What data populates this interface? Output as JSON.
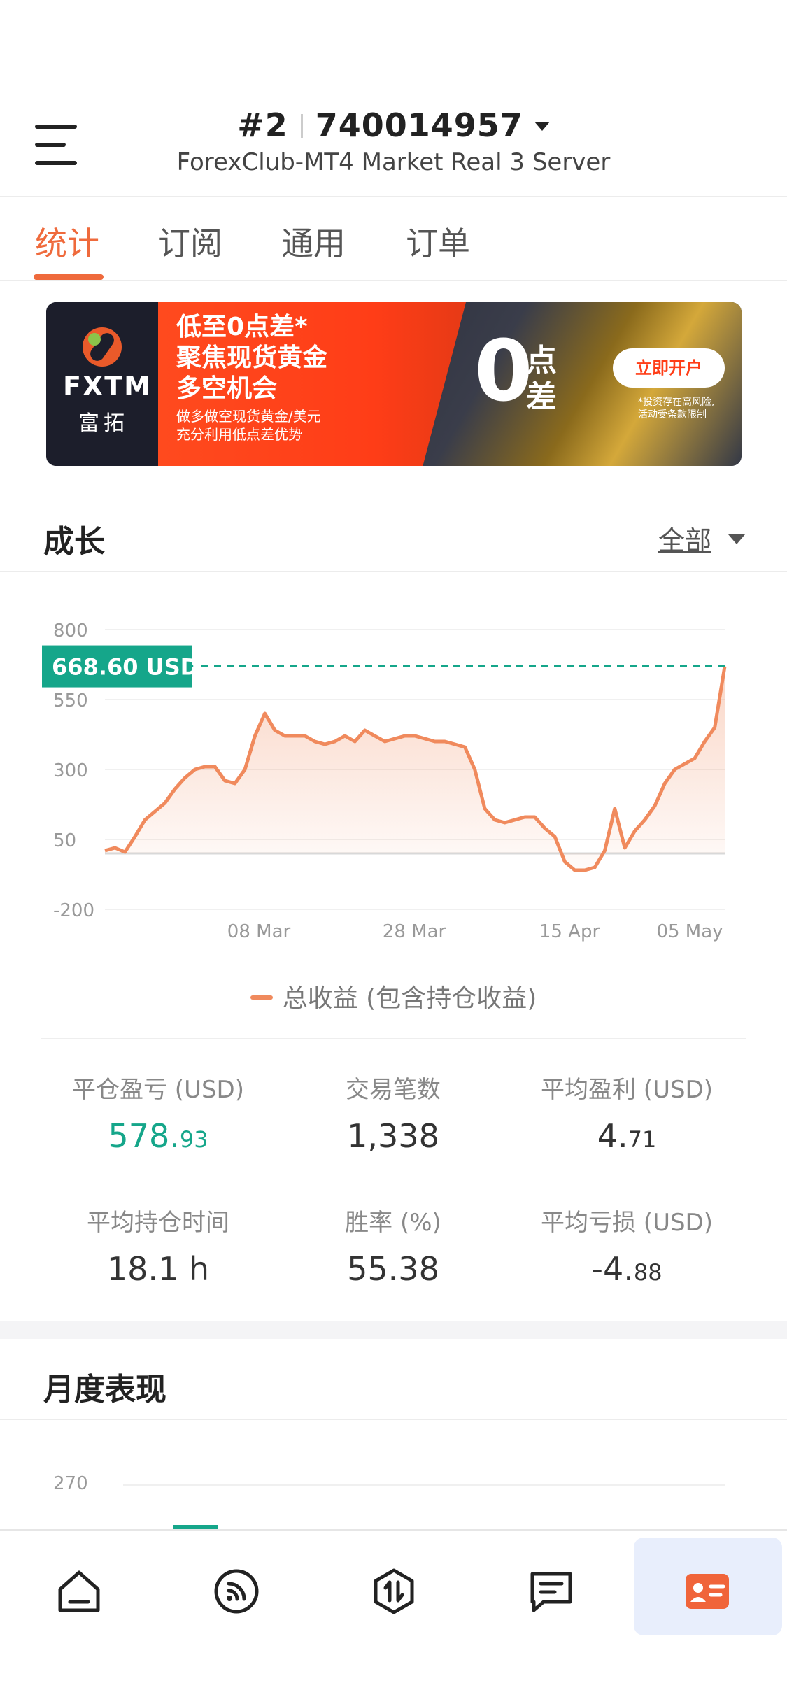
{
  "header": {
    "account_index": "#2",
    "account_number": "740014957",
    "server": "ForexClub-MT4 Market Real 3 Server"
  },
  "tabs": [
    "统计",
    "订阅",
    "通用",
    "订单"
  ],
  "banner": {
    "brand": "FXTM",
    "brand_cn": "富拓",
    "headline": [
      "低至0点差*",
      "聚焦现货黄金",
      "多空机会"
    ],
    "sub": [
      "做多做空现货黄金/美元",
      "充分利用低点差优势"
    ],
    "zero": "0",
    "zero_cn": [
      "点",
      "差"
    ],
    "cta": "立即开户",
    "risk": [
      "*投资存在高风险,",
      "活动受条款限制"
    ]
  },
  "growth": {
    "title": "成长",
    "filter": "全部"
  },
  "chart_data": {
    "type": "area",
    "ylim": [
      -200,
      800
    ],
    "y_ticks": [
      800,
      550,
      300,
      50,
      -200
    ],
    "x_tick_labels": [
      "08 Mar",
      "28 Mar",
      "15 Apr",
      "05 May"
    ],
    "current_label": "668.60 USD",
    "current_value": 668.6,
    "series": [
      {
        "name": "总收益 (包含持仓收益)",
        "color": "#f08a5d",
        "values": [
          10,
          20,
          5,
          60,
          120,
          150,
          180,
          230,
          270,
          300,
          310,
          310,
          260,
          250,
          300,
          420,
          500,
          440,
          420,
          420,
          420,
          400,
          390,
          400,
          420,
          400,
          440,
          420,
          400,
          410,
          420,
          420,
          410,
          400,
          400,
          390,
          380,
          300,
          160,
          120,
          110,
          120,
          130,
          130,
          90,
          60,
          -30,
          -60,
          -60,
          -50,
          10,
          160,
          20,
          80,
          120,
          170,
          250,
          300,
          320,
          340,
          400,
          450,
          668.6
        ]
      }
    ]
  },
  "legend": "总收益 (包含持仓收益)",
  "stats": [
    {
      "label": "平仓盈亏 (USD)",
      "value_main": "578.",
      "value_dec": "93",
      "highlight": true
    },
    {
      "label": "交易笔数",
      "value_main": "1,338",
      "value_dec": "",
      "highlight": false
    },
    {
      "label": "平均盈利 (USD)",
      "value_main": "4.",
      "value_dec": "71",
      "highlight": false
    },
    {
      "label": "平均持仓时间",
      "value_main": "18.1 h",
      "value_dec": "",
      "highlight": false
    },
    {
      "label": "胜率 (%)",
      "value_main": "55.38",
      "value_dec": "",
      "highlight": false
    },
    {
      "label": "平均亏损 (USD)",
      "value_main": "-4.",
      "value_dec": "88",
      "highlight": false
    }
  ],
  "monthly": {
    "title": "月度表现",
    "first_tick": "270"
  },
  "nav": [
    "home-icon",
    "feed-icon",
    "trade-icon",
    "messages-icon",
    "profile-card-icon"
  ],
  "colors": {
    "accent": "#ef6a3c",
    "teal": "#15a68a",
    "line": "#f08a5d",
    "nav_active_bg": "#e8eefc"
  }
}
